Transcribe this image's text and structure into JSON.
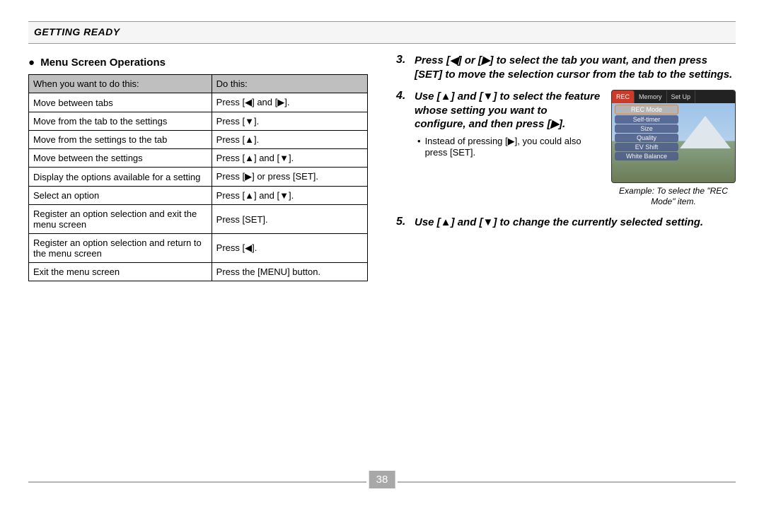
{
  "header": {
    "title": "GETTING READY"
  },
  "leftColumn": {
    "heading": "Menu Screen Operations",
    "tableHeaders": {
      "c1": "When you want to do this:",
      "c2": "Do this:"
    },
    "rows": [
      {
        "c1": "Move between tabs",
        "c2": "Press [◀] and [▶]."
      },
      {
        "c1": "Move from the tab to the settings",
        "c2": "Press [▼]."
      },
      {
        "c1": "Move from the settings to the tab",
        "c2": "Press [▲]."
      },
      {
        "c1": "Move between the settings",
        "c2": "Press [▲] and [▼]."
      },
      {
        "c1": "Display the options available for a setting",
        "c2": "Press [▶] or press [SET]."
      },
      {
        "c1": "Select an option",
        "c2": "Press [▲] and [▼]."
      },
      {
        "c1": "Register an option selection and exit the menu screen",
        "c2": "Press [SET]."
      },
      {
        "c1": "Register an option selection and return to the menu screen",
        "c2": "Press [◀]."
      },
      {
        "c1": "Exit the menu screen",
        "c2": "Press the [MENU] button."
      }
    ]
  },
  "rightColumn": {
    "steps": {
      "s3": {
        "num": "3.",
        "text": "Press [◀] or [▶] to select the tab you want, and then press [SET] to move the selection cursor from the tab to the settings."
      },
      "s4": {
        "num": "4.",
        "text": "Use [▲] and [▼] to select the feature whose setting you want to configure, and then press [▶].",
        "sub": "Instead of pressing [▶], you could also press [SET]."
      },
      "s5": {
        "num": "5.",
        "text": "Use [▲] and [▼] to change the currently selected setting."
      }
    },
    "example": {
      "caption": "Example: To select the \"REC Mode\" item.",
      "tabs": [
        "REC",
        "Memory",
        "Set Up"
      ],
      "items": [
        "REC Mode",
        "Self-timer",
        "Size",
        "Quality",
        "EV Shift",
        "White Balance"
      ]
    }
  },
  "pageNumber": "38"
}
